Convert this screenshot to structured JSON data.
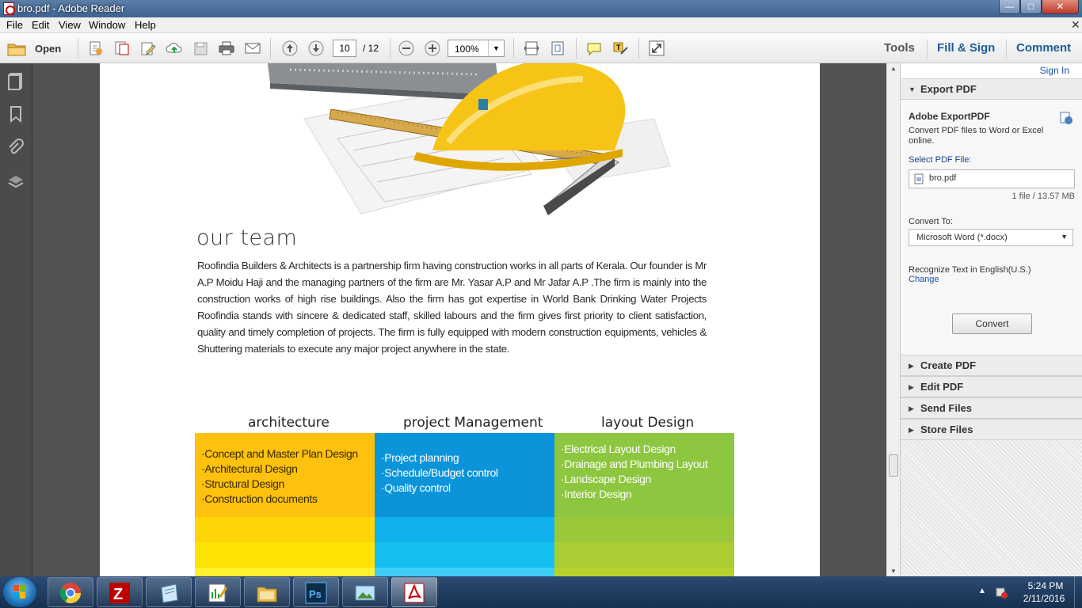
{
  "window": {
    "title": "bro.pdf - Adobe Reader",
    "min": "—",
    "max": "□",
    "close": "✕"
  },
  "menu": [
    "File",
    "Edit",
    "View",
    "Window",
    "Help"
  ],
  "toolbar": {
    "open_label": "Open",
    "page_current": "10",
    "page_total": "/ 12",
    "zoom": "100%",
    "tools": "Tools",
    "fill_sign": "Fill & Sign",
    "comment": "Comment"
  },
  "document": {
    "heading": "our team",
    "paragraph": "Roofindia Builders & Architects is a partnership firm having construction works in all parts of Kerala. Our founder is Mr A.P Moidu Haji and the managing partners of the firm are Mr. Yasar A.P and Mr Jafar A.P .The firm is mainly into the construction works of high rise buildings. Also the firm has got expertise in World Bank Drinking Water Projects Roofindia stands with sincere & dedicated staff, skilled labours and the firm gives first priority to client satisfaction, quality and timely completion of projects. The firm is fully equipped with modern construction equipments, vehicles & Shuttering materials to execute any major project anywhere in the state.",
    "columns": [
      {
        "title": "architecture",
        "color": "#fec10e",
        "items": [
          "Concept and Master Plan Design",
          "Architectural Design",
          "Structural Design",
          "Construction documents"
        ]
      },
      {
        "title": "project Management",
        "color": "#0b94d9",
        "items": [
          "Project planning",
          "Schedule/Budget control",
          "Quality control"
        ]
      },
      {
        "title": "layout Design",
        "color": "#8dc63f",
        "items": [
          "Electrical Layout Design",
          "Drainage and Plumbing Layout",
          "Landscape Design",
          "Interior Design"
        ]
      }
    ]
  },
  "right_pane": {
    "sign_in": "Sign In",
    "export": {
      "header": "Export PDF",
      "title": "Adobe ExportPDF",
      "desc": "Convert PDF files to Word or Excel online.",
      "select_label": "Select PDF File:",
      "file_name": "bro.pdf",
      "file_info": "1 file / 13.57 MB",
      "convert_to_label": "Convert To:",
      "convert_to_value": "Microsoft Word (*.docx)",
      "recognize": "Recognize Text in English(U.S.)",
      "change": "Change",
      "convert_button": "Convert"
    },
    "sections": [
      "Create PDF",
      "Edit PDF",
      "Send Files",
      "Store Files"
    ]
  },
  "taskbar": {
    "time": "5:24 PM",
    "date": "2/11/2016",
    "apps": [
      "chrome-icon",
      "filezilla-icon",
      "notepad-icon",
      "edit-chart-icon",
      "file-explorer-icon",
      "photoshop-icon",
      "photo-viewer-icon",
      "adobe-reader-icon"
    ]
  }
}
